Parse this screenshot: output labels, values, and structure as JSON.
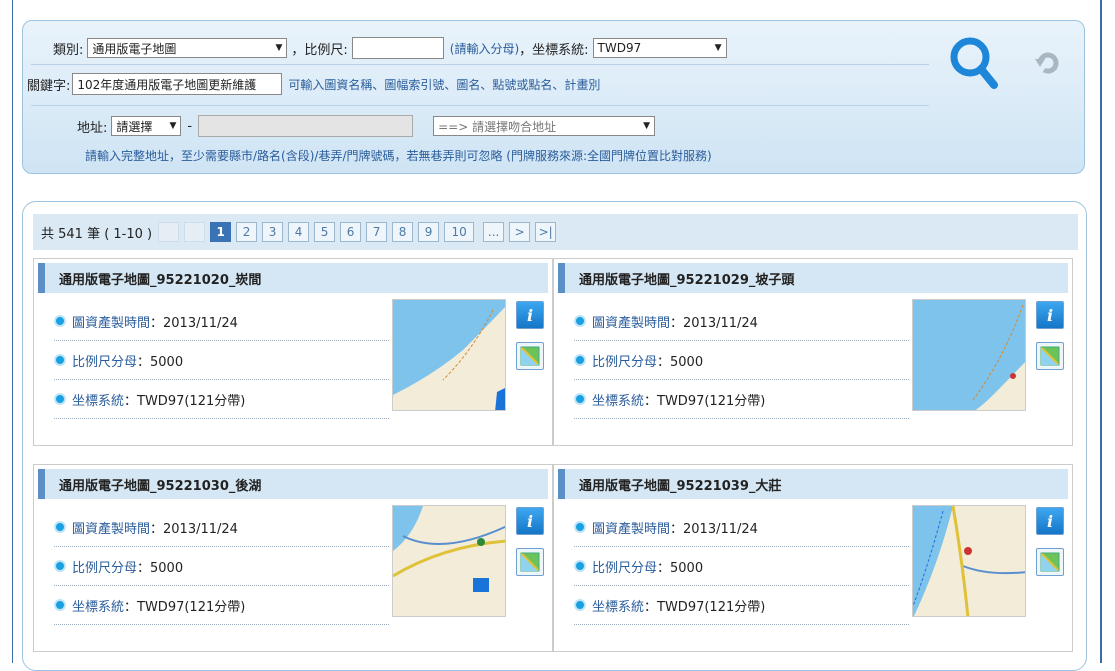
{
  "search": {
    "category_label": "類別:",
    "category_value": "通用版電子地圖",
    "scale_label": "，比例尺:",
    "scale_value": "",
    "scale_hint": "(請輸入分母)",
    "coord_label": "，坐標系統:",
    "coord_value": "TWD97",
    "keyword_label": "關鍵字:",
    "keyword_value": "102年度通用版電子地圖更新維護",
    "keyword_hint": "可輸入圖資名稱、圖幅索引號、圖名、點號或點名、計畫別",
    "address_label": "地址:",
    "address_select": "請選擇",
    "address_dash": "-",
    "address_input": "",
    "match_select": "==> 請選擇吻合地址",
    "address_note": "請輸入完整地址，至少需要縣市/路名(含段)/巷弄/門牌號碼，若無巷弄則可忽略 (門牌服務來源:全國門牌位置比對服務)"
  },
  "pager": {
    "total": "共 541 筆 ( 1-10 )",
    "pages": [
      "1",
      "2",
      "3",
      "4",
      "5",
      "6",
      "7",
      "8",
      "9",
      "10"
    ],
    "ellipsis": "...",
    "next": ">",
    "last": ">|"
  },
  "result_labels": {
    "time": "圖資產製時間",
    "scale": "比例尺分母",
    "coord": "坐標系統"
  },
  "results": [
    {
      "title": "通用版電子地圖_95221020_崁間",
      "time": "：2013/11/24",
      "scale": " ：5000",
      "coord": " ：TWD97(121分帶)"
    },
    {
      "title": "通用版電子地圖_95221029_坡子頭",
      "time": "：2013/11/24",
      "scale": " ：5000",
      "coord": " ：TWD97(121分帶)"
    },
    {
      "title": "通用版電子地圖_95221030_後湖",
      "time": "：2013/11/24",
      "scale": " ：5000",
      "coord": " ：TWD97(121分帶)"
    },
    {
      "title": "通用版電子地圖_95221039_大莊",
      "time": "：2013/11/24",
      "scale": " ：5000",
      "coord": " ：TWD97(121分帶)"
    }
  ],
  "colors": {
    "accent": "#3a73b5",
    "panel": "#dbe9f4",
    "link": "#2a5d9c"
  }
}
